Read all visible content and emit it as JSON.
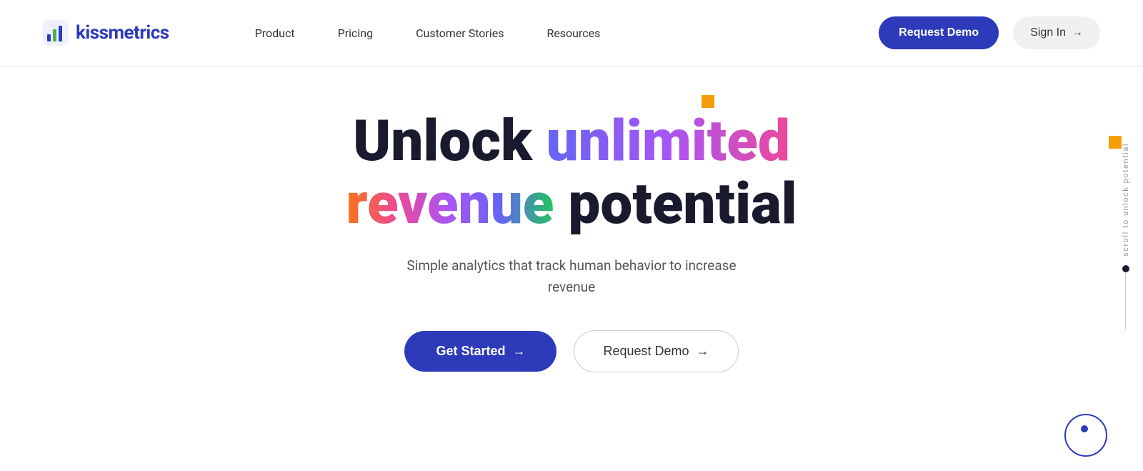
{
  "nav": {
    "logo_text": "kissmetrics",
    "links": [
      {
        "label": "Product",
        "id": "product"
      },
      {
        "label": "Pricing",
        "id": "pricing"
      },
      {
        "label": "Customer Stories",
        "id": "customer-stories"
      },
      {
        "label": "Resources",
        "id": "resources"
      }
    ],
    "cta_primary": "Request Demo",
    "cta_secondary": "Sign In",
    "sign_in_arrow": "→"
  },
  "hero": {
    "title_word1": "Unlock",
    "title_word2": "unlimited",
    "title_word3": "revenue",
    "title_word4": "potential",
    "subtitle": "Simple analytics that track human behavior to increase revenue",
    "btn_get_started": "Get Started",
    "btn_get_started_arrow": "→",
    "btn_request_demo": "Request Demo",
    "btn_request_demo_arrow": "→"
  },
  "scroll_indicator": {
    "label": "scroll to unlock potential"
  },
  "colors": {
    "brand_blue": "#2d3aba",
    "orange_deco": "#f59e0b"
  }
}
